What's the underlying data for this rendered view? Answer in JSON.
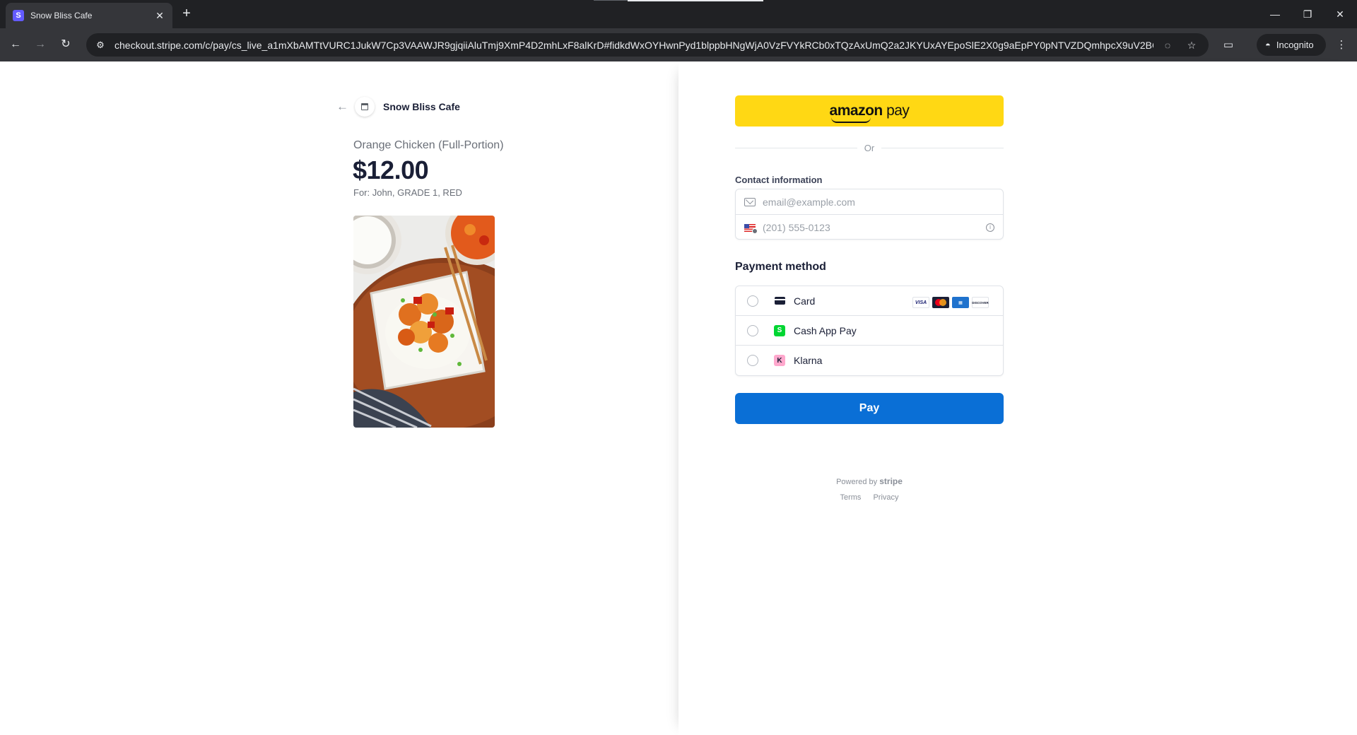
{
  "browser": {
    "tab_title": "Snow Bliss Cafe",
    "tab_favicon_letter": "S",
    "url": "checkout.stripe.com/c/pay/cs_live_a1mXbAMTtVURC1JukW7Cp3VAAWJR9gjqiiAluTmj9XmP4D2mhLxF8alKrD#fidkdWxOYHwnPyd1blppbHNgWjA0VzFVYkRCb0xTQzAxUmQ2a2JKYUxAYEpoSlE2X0g9aEpPY0pNTVZDQmhpcX9uV2BCdXU0TG...",
    "incognito_label": "Incognito"
  },
  "merchant": {
    "name": "Snow Bliss Cafe"
  },
  "product": {
    "name": "Orange Chicken (Full-Portion)",
    "price": "$12.00",
    "for_line": "For: John, GRADE 1, RED"
  },
  "checkout": {
    "amazon_pay_brand": "amazon",
    "amazon_pay_word": "pay",
    "or_label": "Or",
    "contact_label": "Contact information",
    "email_placeholder": "email@example.com",
    "phone_placeholder": "(201) 555-0123",
    "payment_method_title": "Payment method",
    "methods": [
      {
        "label": "Card",
        "icon": "card-icon"
      },
      {
        "label": "Cash App Pay",
        "icon": "cash-app-icon",
        "glyph": "S"
      },
      {
        "label": "Klarna",
        "icon": "klarna-icon",
        "glyph": "K"
      }
    ],
    "card_brands": [
      "VISA",
      "",
      "",
      "DISCOVER"
    ],
    "pay_label": "Pay",
    "powered_by": "Powered by",
    "powered_brand": "stripe",
    "terms_label": "Terms",
    "privacy_label": "Privacy"
  },
  "colors": {
    "amazon_yellow": "#ffd814",
    "pay_blue": "#0a6fd6",
    "cash_app_green": "#00d632",
    "klarna_pink": "#ffa8cd",
    "stripe_purple": "#635bff"
  }
}
